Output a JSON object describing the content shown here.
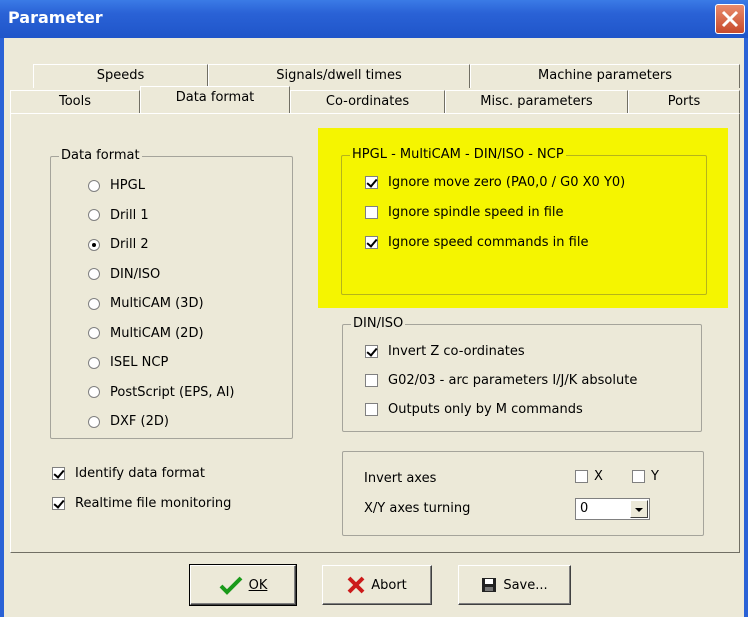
{
  "window": {
    "title": "Parameter"
  },
  "tabs_top": [
    "Speeds",
    "Signals/dwell times",
    "Machine parameters"
  ],
  "tabs_bottom": [
    "Tools",
    "Data format",
    "Co-ordinates",
    "Misc. parameters",
    "Ports"
  ],
  "data_format": {
    "title": "Data format",
    "options": [
      "HPGL",
      "Drill 1",
      "Drill 2",
      "DIN/ISO",
      "MultiCAM (3D)",
      "MultiCAM (2D)",
      "ISEL NCP",
      "PostScript (EPS, AI)",
      "DXF (2D)"
    ],
    "selected": "Drill 2"
  },
  "identify": {
    "label": "Identify data format",
    "checked": true
  },
  "realtime": {
    "label": "Realtime file monitoring",
    "checked": true
  },
  "hpgl_group": {
    "title": "HPGL - MultiCAM - DIN/ISO - NCP",
    "highlight_color": "#f5f500",
    "items": [
      {
        "label": "Ignore move zero (PA0,0 / G0 X0 Y0)",
        "checked": true
      },
      {
        "label": "Ignore spindle speed in file",
        "checked": false
      },
      {
        "label": "Ignore speed commands in file",
        "checked": true
      }
    ]
  },
  "din_group": {
    "title": "DIN/ISO",
    "items": [
      {
        "label": "Invert Z co-ordinates",
        "checked": true
      },
      {
        "label": "G02/03 - arc parameters I/J/K absolute",
        "checked": false
      },
      {
        "label": "Outputs only by M commands",
        "checked": false
      }
    ]
  },
  "axes": {
    "invert_label": "Invert axes",
    "x_label": "X",
    "y_label": "Y",
    "x_checked": false,
    "y_checked": false,
    "turning_label": "X/Y axes turning",
    "turning_value": "0"
  },
  "buttons": {
    "ok": "OK",
    "abort": "Abort",
    "save": "Save..."
  }
}
